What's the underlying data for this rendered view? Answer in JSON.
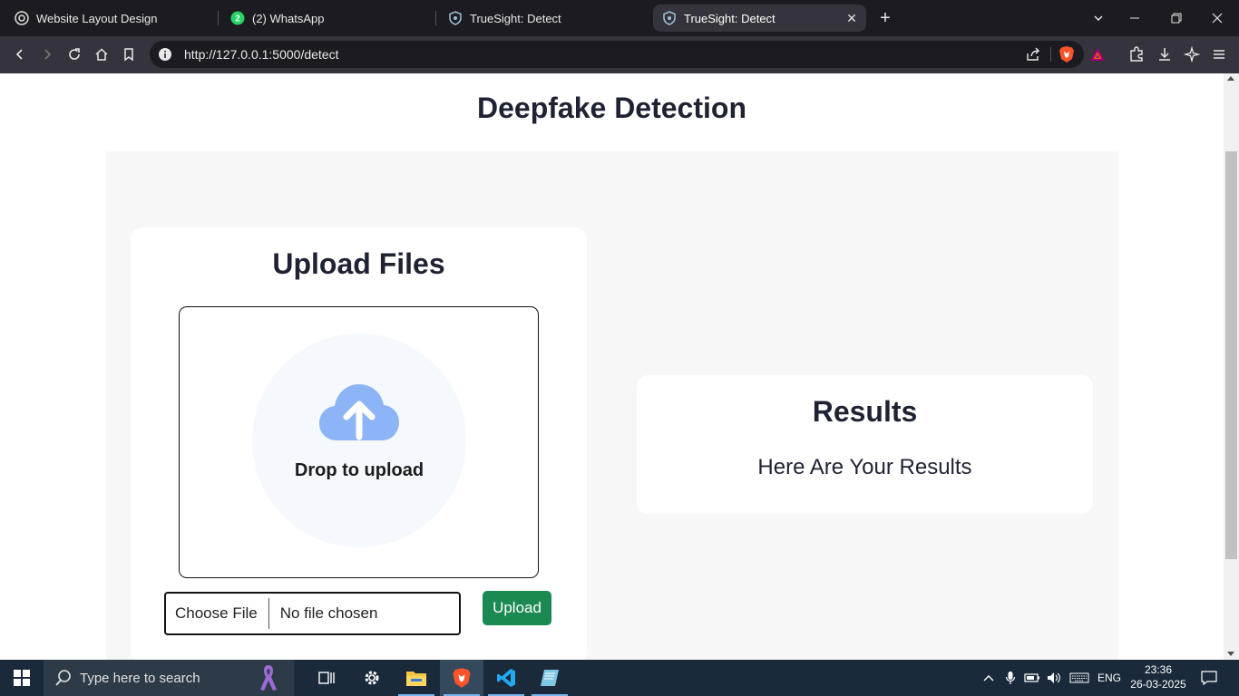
{
  "browser": {
    "tabs": [
      {
        "title": "Website Layout Design"
      },
      {
        "title": "(2) WhatsApp",
        "badge": "2"
      },
      {
        "title": "TrueSight: Detect"
      },
      {
        "title": "TrueSight: Detect",
        "active": true
      }
    ],
    "url": "http://127.0.0.1:5000/detect"
  },
  "page": {
    "title": "Deepfake Detection",
    "upload": {
      "heading": "Upload Files",
      "drop_text": "Drop to upload",
      "choose_file": "Choose File",
      "file_status": "No file chosen",
      "upload_button": "Upload"
    },
    "results": {
      "heading": "Results",
      "text": "Here Are Your Results"
    }
  },
  "taskbar": {
    "search_placeholder": "Type here to search",
    "language": "ENG",
    "time": "23:36",
    "date": "26-03-2025"
  },
  "colors": {
    "upload_button": "#1b8a52",
    "cloud_icon": "#8db4f7",
    "panel_bg": "#f7f7f7"
  }
}
